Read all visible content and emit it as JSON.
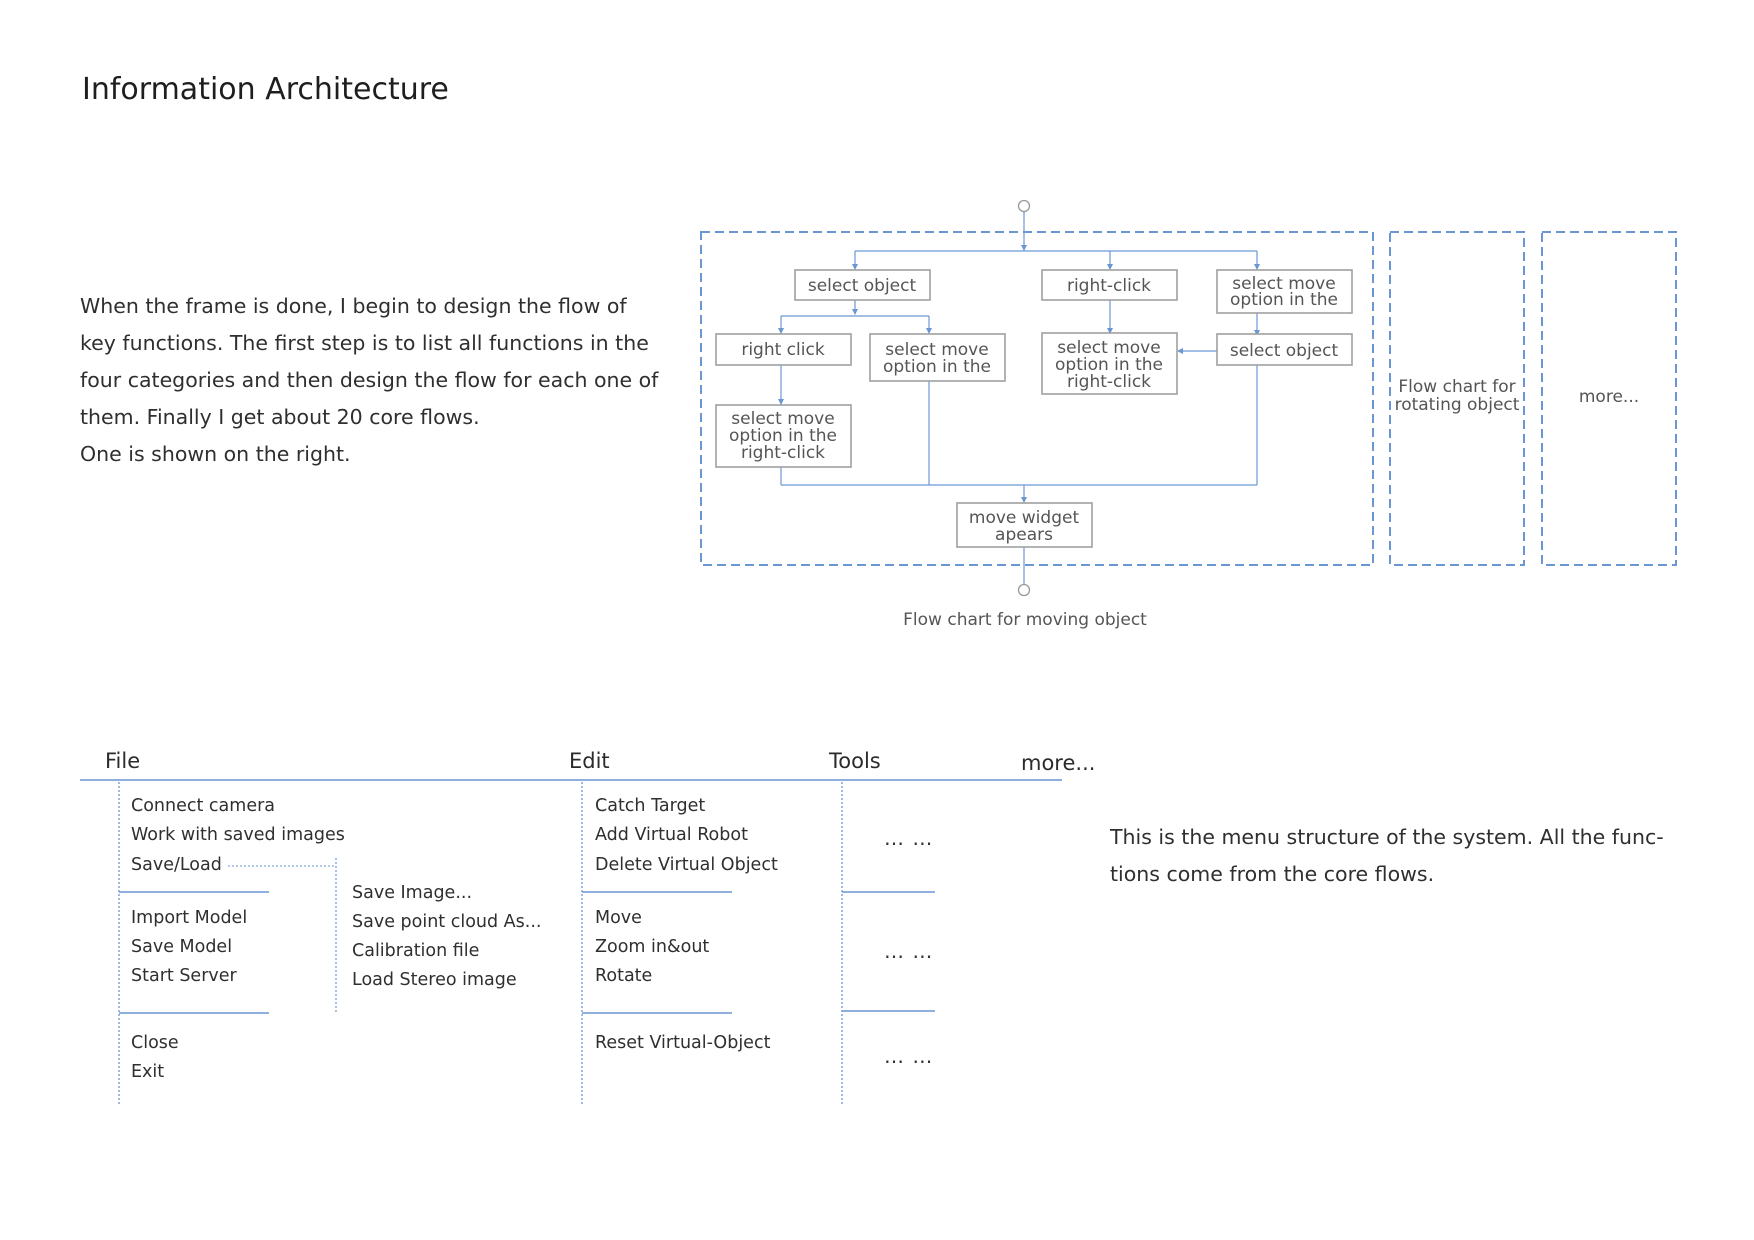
{
  "title": "Information Architecture",
  "intro": [
    "When the frame is done, I begin to design the flow of",
    "key functions. The first step is to list all functions in the",
    "four categories and then design the flow for each one of",
    "them. Finally I get about 20 core flows.",
    "One is shown on the right."
  ],
  "flowchart": {
    "caption": "Flow chart for moving object",
    "nodes": {
      "select_object_1": [
        "select object"
      ],
      "right_click_top": [
        "right-click"
      ],
      "select_move_top": [
        "select move",
        "option in the"
      ],
      "right_click_mid": [
        "right click"
      ],
      "select_move_mid_left": [
        "select move",
        "option in the"
      ],
      "select_move_mid_right": [
        "select move",
        "option in the",
        "right-click"
      ],
      "select_object_2": [
        "select object"
      ],
      "select_move_bottom": [
        "select move",
        "option in the",
        "right-click"
      ],
      "move_widget": [
        "move widget",
        "apears"
      ]
    },
    "side_panels": [
      [
        "Flow chart for",
        "rotating object"
      ],
      [
        "more..."
      ]
    ],
    "accent_color": "#6a96d4",
    "box_border_color": "#a0a0a0"
  },
  "menu": {
    "headers": [
      "File",
      "Edit",
      "Tools",
      "more..."
    ],
    "file_items": {
      "group1": [
        "Connect camera",
        "Work with saved images",
        "Save/Load"
      ],
      "group2": [
        "Import Model",
        "Save Model",
        "Start Server"
      ],
      "group3": [
        "Close",
        "Exit"
      ]
    },
    "save_load_submenu": [
      "Save Image...",
      "Save point cloud As...",
      "Calibration file",
      "Load Stereo image"
    ],
    "edit_items": {
      "group1": [
        "Catch Target",
        "Add Virtual Robot",
        "Delete Virtual Object"
      ],
      "group2": [
        "Move",
        "Zoom in&out",
        "Rotate"
      ],
      "group3": [
        "Reset Virtual-Object"
      ]
    },
    "tools_placeholder": [
      "… …",
      "… …",
      "… …"
    ],
    "line_color": "#6a96d4"
  },
  "menu_description": [
    "This is the menu structure of the system. All the func-",
    "tions come from the core flows."
  ]
}
